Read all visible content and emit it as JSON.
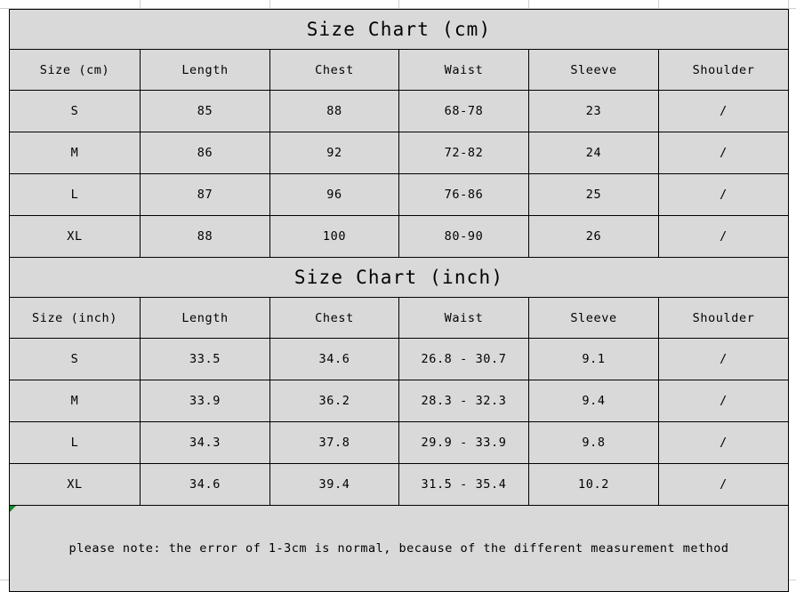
{
  "chart_data": {
    "type": "table",
    "title": "Size Chart",
    "tables": [
      {
        "title": "Size Chart (cm)",
        "unit": "cm",
        "columns": [
          "Size (cm)",
          "Length",
          "Chest",
          "Waist",
          "Sleeve",
          "Shoulder"
        ],
        "rows": [
          [
            "S",
            "85",
            "88",
            "68-78",
            "23",
            "/"
          ],
          [
            "M",
            "86",
            "92",
            "72-82",
            "24",
            "/"
          ],
          [
            "L",
            "87",
            "96",
            "76-86",
            "25",
            "/"
          ],
          [
            "XL",
            "88",
            "100",
            "80-90",
            "26",
            "/"
          ]
        ]
      },
      {
        "title": "Size Chart (inch)",
        "unit": "inch",
        "columns": [
          "Size (inch)",
          "Length",
          "Chest",
          "Waist",
          "Sleeve",
          "Shoulder"
        ],
        "rows": [
          [
            "S",
            "33.5",
            "34.6",
            "26.8 - 30.7",
            "9.1",
            "/"
          ],
          [
            "M",
            "33.9",
            "36.2",
            "28.3 - 32.3",
            "9.4",
            "/"
          ],
          [
            "L",
            "34.3",
            "37.8",
            "29.9 - 33.9",
            "9.8",
            "/"
          ],
          [
            "XL",
            "34.6",
            "39.4",
            "31.5 - 35.4",
            "10.2",
            "/"
          ]
        ]
      }
    ],
    "note": "please note: the error of 1-3cm is normal, because of the different measurement method"
  },
  "cm_table": {
    "title": "Size Chart (cm)",
    "headers": {
      "size": "Size (cm)",
      "length": "Length",
      "chest": "Chest",
      "waist": "Waist",
      "sleeve": "Sleeve",
      "shoulder": "Shoulder"
    },
    "rows": [
      {
        "size": "S",
        "length": "85",
        "chest": "88",
        "waist": "68-78",
        "sleeve": "23",
        "shoulder": "/"
      },
      {
        "size": "M",
        "length": "86",
        "chest": "92",
        "waist": "72-82",
        "sleeve": "24",
        "shoulder": "/"
      },
      {
        "size": "L",
        "length": "87",
        "chest": "96",
        "waist": "76-86",
        "sleeve": "25",
        "shoulder": "/"
      },
      {
        "size": "XL",
        "length": "88",
        "chest": "100",
        "waist": "80-90",
        "sleeve": "26",
        "shoulder": "/"
      }
    ]
  },
  "inch_table": {
    "title": "Size Chart (inch)",
    "headers": {
      "size": "Size (inch)",
      "length": "Length",
      "chest": "Chest",
      "waist": "Waist",
      "sleeve": "Sleeve",
      "shoulder": "Shoulder"
    },
    "rows": [
      {
        "size": "S",
        "length": "33.5",
        "chest": "34.6",
        "waist": "26.8 - 30.7",
        "sleeve": "9.1",
        "shoulder": "/"
      },
      {
        "size": "M",
        "length": "33.9",
        "chest": "36.2",
        "waist": "28.3 - 32.3",
        "sleeve": "9.4",
        "shoulder": "/"
      },
      {
        "size": "L",
        "length": "34.3",
        "chest": "37.8",
        "waist": "29.9 - 33.9",
        "sleeve": "9.8",
        "shoulder": "/"
      },
      {
        "size": "XL",
        "length": "34.6",
        "chest": "39.4",
        "waist": "31.5 - 35.4",
        "sleeve": "10.2",
        "shoulder": "/"
      }
    ]
  },
  "footer": {
    "note": "please note: the error of 1-3cm is normal, because of the different measurement method"
  },
  "colors": {
    "cell_background": "#d9d9d9",
    "border": "#000000",
    "text": "#000000",
    "sheet_grid": "#d0d0d0",
    "comment_marker": "#128a28",
    "page_background": "#ffffff"
  }
}
